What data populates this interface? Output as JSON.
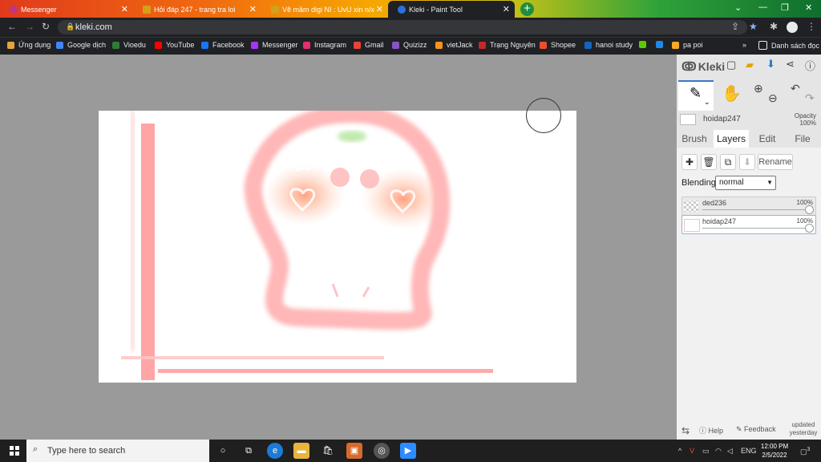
{
  "browser": {
    "tabs": [
      {
        "title": "Messenger",
        "color": "#c13584"
      },
      {
        "title": "Hỏi đáp 247 - trang tra loi",
        "color": "#d4a017"
      },
      {
        "title": "Vẽ mầm digi NI : UvU xin n/x o ;",
        "color": "#d4a017"
      },
      {
        "title": "Kleki - Paint Tool",
        "color": "#2f6fdd"
      }
    ],
    "new_tab": "+",
    "url": "kleki.com",
    "bookmarks": [
      {
        "label": "Ứng dụng",
        "color": "#e8a33a"
      },
      {
        "label": "Google dịch",
        "color": "#4285f4"
      },
      {
        "label": "Vioedu",
        "color": "#2e7d32"
      },
      {
        "label": "YouTube",
        "color": "#ff0000"
      },
      {
        "label": "Facebook",
        "color": "#1877f2"
      },
      {
        "label": "Messenger",
        "color": "#a334fa"
      },
      {
        "label": "Instagram",
        "color": "#e1306c"
      },
      {
        "label": "Gmail",
        "color": "#ea4335"
      },
      {
        "label": "Quizizz",
        "color": "#8854c0"
      },
      {
        "label": "vietJack",
        "color": "#f7931e"
      },
      {
        "label": "Trạng Nguyên",
        "color": "#c62828"
      },
      {
        "label": "Shopee",
        "color": "#ee4d2d"
      },
      {
        "label": "hanoi study",
        "color": "#1565c0"
      },
      {
        "label": "",
        "color": "#58cc02"
      },
      {
        "label": "",
        "color": "#1e88e5"
      },
      {
        "label": "pa poi",
        "color": "#f9a825"
      }
    ],
    "bookmarks_more": "»",
    "reading_list": "Danh sách đọc"
  },
  "kleki": {
    "logo": "Kleki",
    "layer_name": "hoidap247",
    "opacity_label": "Opacity",
    "opacity_value": "100%",
    "tabs": [
      "Brush",
      "Layers",
      "Edit",
      "File"
    ],
    "active_tab": "Layers",
    "rename": "Rename",
    "blending_label": "Blending",
    "blending_value": "normal",
    "layers": [
      {
        "name": "ded236",
        "opacity": "100%",
        "selected": false
      },
      {
        "name": "hoidap247",
        "opacity": "100%",
        "selected": true
      }
    ],
    "help": "Help",
    "feedback": "Feedback",
    "updated": "updated yesterday"
  },
  "taskbar": {
    "search_placeholder": "Type here to search",
    "lang": "ENG",
    "time": "12:00 PM",
    "date": "2/5/2022",
    "notifications": "3"
  }
}
